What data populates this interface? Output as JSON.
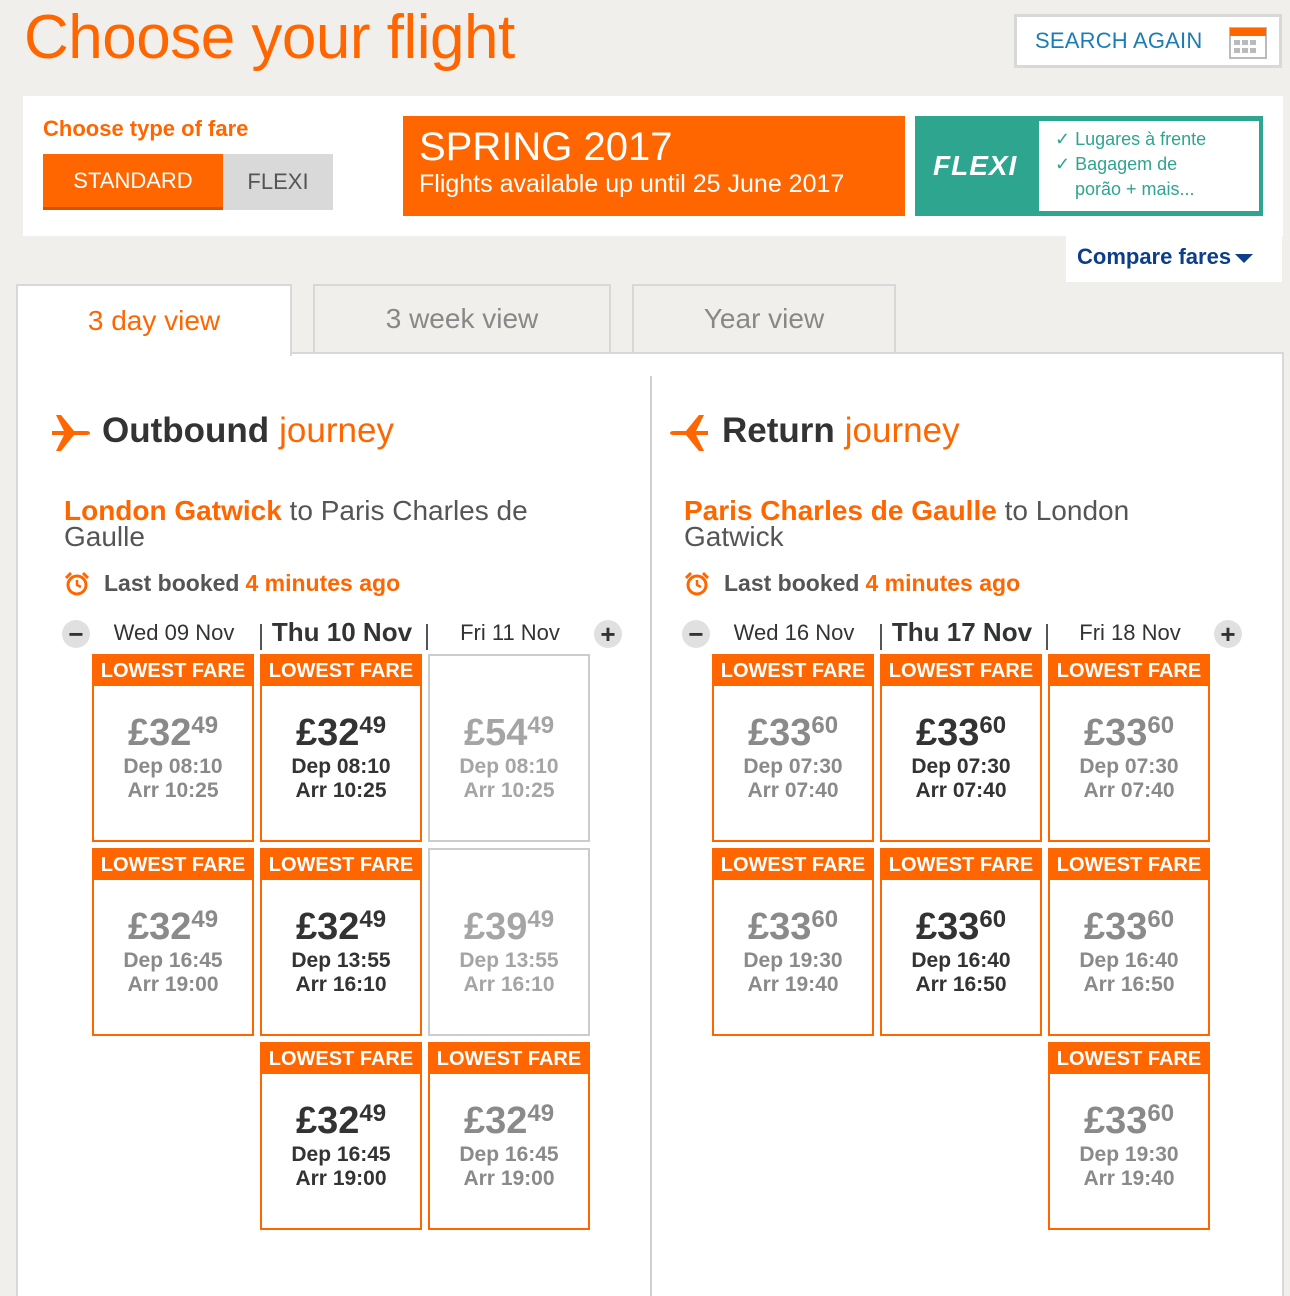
{
  "header": {
    "title": "Choose your flight",
    "search_again": "SEARCH AGAIN"
  },
  "fare": {
    "label": "Choose type of fare",
    "standard": "STANDARD",
    "flexi": "FLEXI",
    "selected": "STANDARD"
  },
  "banners": {
    "spring_title": "SPRING 2017",
    "spring_sub": "Flights available up until 25 June 2017",
    "flexi_word": "FLEXI",
    "flexi_line1": "✓ Lugares à frente",
    "flexi_line2": "✓ Bagagem de",
    "flexi_line3": "porão + mais..."
  },
  "compare_fares": "Compare fares",
  "tabs": [
    "3 day view",
    "3 week view",
    "Year view"
  ],
  "colors": {
    "accent": "#ff6600",
    "flexi": "#2ea58f",
    "link": "#1c7db5"
  },
  "outbound": {
    "heading_bold": "Outbound",
    "heading_light": "journey",
    "from": "London Gatwick",
    "to_text": " to Paris Charles de Gaulle",
    "booked_label": "Last booked",
    "booked_ago": "4 minutes ago",
    "dates": [
      "Wed 09 Nov",
      "Thu 10 Nov",
      "Fri 11 Nov"
    ],
    "flights": [
      {
        "badge": "LOWEST FARE",
        "pounds": "£32",
        "pence": "49",
        "dep": "Dep 08:10",
        "arr": "Arr 10:25"
      },
      {
        "badge": "LOWEST FARE",
        "pounds": "£32",
        "pence": "49",
        "dep": "Dep 16:45",
        "arr": "Arr 19:00"
      },
      {
        "badge": "LOWEST FARE",
        "pounds": "£32",
        "pence": "49",
        "dep": "Dep 08:10",
        "arr": "Arr 10:25"
      },
      {
        "badge": "LOWEST FARE",
        "pounds": "£32",
        "pence": "49",
        "dep": "Dep 13:55",
        "arr": "Arr 16:10"
      },
      {
        "badge": "LOWEST FARE",
        "pounds": "£32",
        "pence": "49",
        "dep": "Dep 16:45",
        "arr": "Arr 19:00"
      },
      {
        "badge": "",
        "pounds": "£54",
        "pence": "49",
        "dep": "Dep 08:10",
        "arr": "Arr 10:25"
      },
      {
        "badge": "",
        "pounds": "£39",
        "pence": "49",
        "dep": "Dep 13:55",
        "arr": "Arr 16:10"
      },
      {
        "badge": "LOWEST FARE",
        "pounds": "£32",
        "pence": "49",
        "dep": "Dep 16:45",
        "arr": "Arr 19:00"
      }
    ]
  },
  "return": {
    "heading_bold": "Return",
    "heading_light": "journey",
    "from": "Paris Charles de Gaulle",
    "to_text": " to London Gatwick",
    "booked_label": "Last booked",
    "booked_ago": "4 minutes ago",
    "dates": [
      "Wed 16 Nov",
      "Thu 17 Nov",
      "Fri 18 Nov"
    ],
    "flights": [
      {
        "badge": "LOWEST FARE",
        "pounds": "£33",
        "pence": "60",
        "dep": "Dep 07:30",
        "arr": "Arr 07:40"
      },
      {
        "badge": "LOWEST FARE",
        "pounds": "£33",
        "pence": "60",
        "dep": "Dep 19:30",
        "arr": "Arr 19:40"
      },
      {
        "badge": "LOWEST FARE",
        "pounds": "£33",
        "pence": "60",
        "dep": "Dep 07:30",
        "arr": "Arr 07:40"
      },
      {
        "badge": "LOWEST FARE",
        "pounds": "£33",
        "pence": "60",
        "dep": "Dep 16:40",
        "arr": "Arr 16:50"
      },
      {
        "badge": "LOWEST FARE",
        "pounds": "£33",
        "pence": "60",
        "dep": "Dep 07:30",
        "arr": "Arr 07:40"
      },
      {
        "badge": "LOWEST FARE",
        "pounds": "£33",
        "pence": "60",
        "dep": "Dep 16:40",
        "arr": "Arr 16:50"
      },
      {
        "badge": "LOWEST FARE",
        "pounds": "£33",
        "pence": "60",
        "dep": "Dep 19:30",
        "arr": "Arr 19:40"
      }
    ]
  }
}
